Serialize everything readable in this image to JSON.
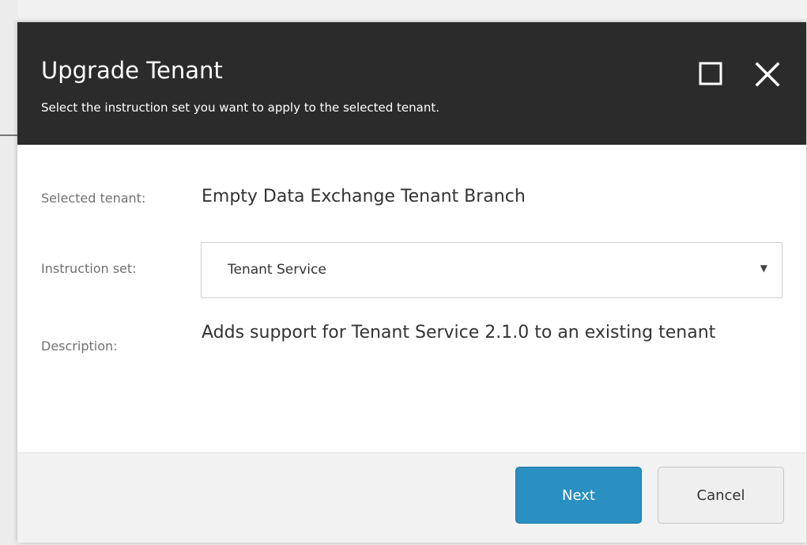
{
  "dialog": {
    "title": "Upgrade Tenant",
    "subtitle": "Select the instruction set you want to apply to the selected tenant.",
    "maximize_icon": "maximize-icon",
    "close_icon": "close-icon"
  },
  "form": {
    "selected_tenant_label": "Selected tenant:",
    "selected_tenant_value": "Empty Data Exchange Tenant Branch",
    "instruction_set_label": "Instruction set:",
    "instruction_set_value": "Tenant Service",
    "description_label": "Description:",
    "description_value": "Adds support for Tenant Service 2.1.0 to an existing tenant"
  },
  "footer": {
    "next_label": "Next",
    "cancel_label": "Cancel"
  },
  "colors": {
    "header_bg": "#2b2b2b",
    "primary_button": "#2a8fc1",
    "footer_bg": "#f2f2f2"
  }
}
